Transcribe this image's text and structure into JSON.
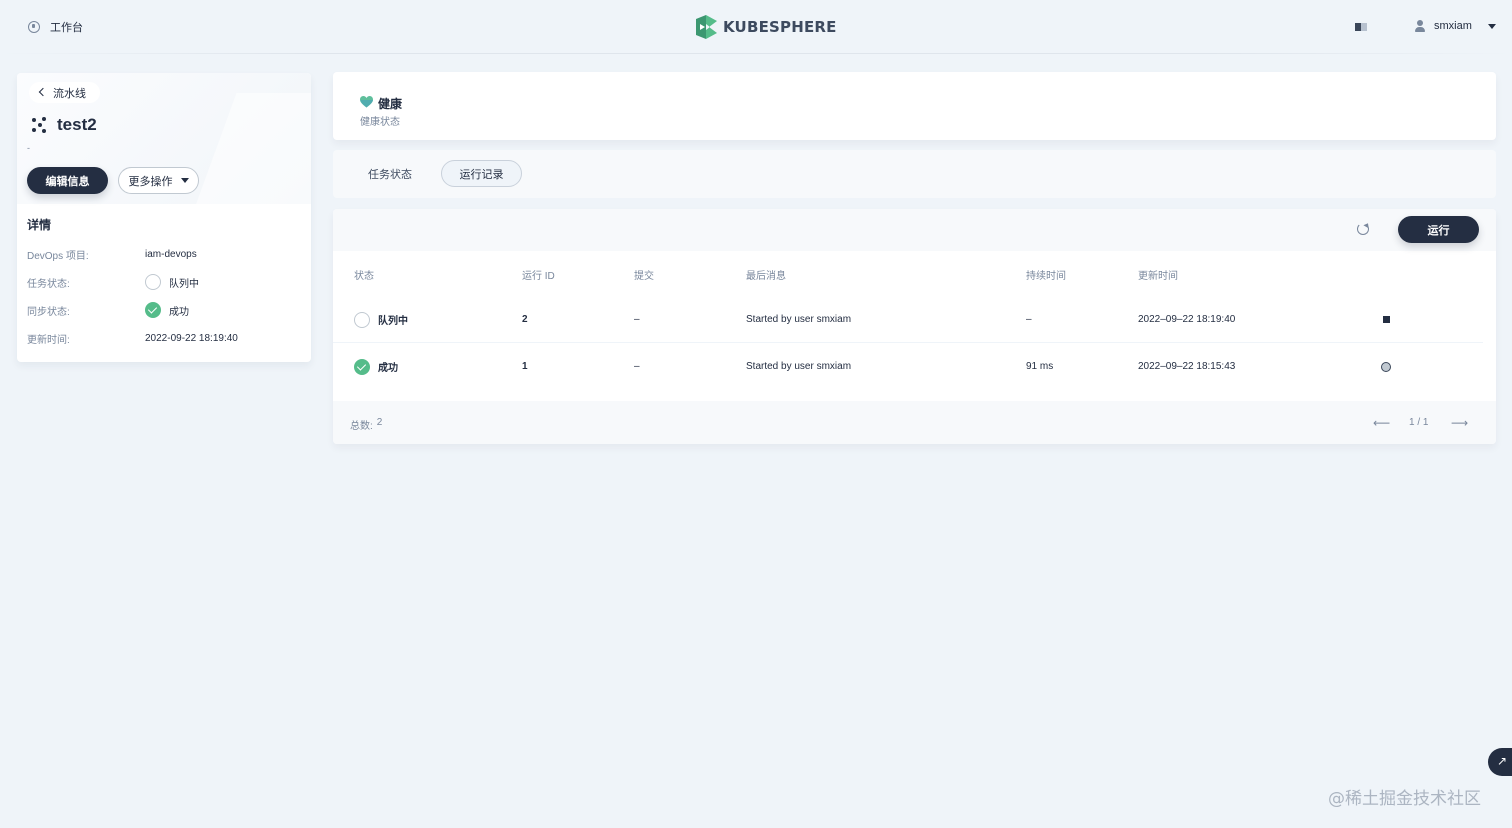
{
  "header": {
    "workbench_label": "工作台",
    "logo_text": "KUBESPHERE",
    "user_name": "smxiam"
  },
  "pipeline": {
    "back_label": "流水线",
    "name": "test2",
    "description": "-",
    "edit_button": "编辑信息",
    "more_button": "更多操作",
    "details_title": "详情",
    "details": [
      {
        "key": "DevOps 项目:",
        "value": "iam-devops",
        "icon": ""
      },
      {
        "key": "任务状态:",
        "value": "队列中",
        "icon": "queued-circle-icon"
      },
      {
        "key": "同步状态:",
        "value": "成功",
        "icon": "success-check-icon"
      },
      {
        "key": "更新时间:",
        "value": "2022-09-22 18:19:40",
        "icon": ""
      }
    ]
  },
  "health": {
    "title": "健康",
    "subtitle": "健康状态",
    "accent_color": "#55bc8a"
  },
  "tabs": [
    {
      "label": "任务状态",
      "active": false
    },
    {
      "label": "运行记录",
      "active": true
    }
  ],
  "runs": {
    "run_button": "运行",
    "columns": [
      "状态",
      "运行 ID",
      "提交",
      "最后消息",
      "持续时间",
      "更新时间"
    ],
    "rows": [
      {
        "status": "队列中",
        "status_icon": "queued-circle-icon",
        "id": "2",
        "commit": "–",
        "message": "Started by user smxiam",
        "duration": "–",
        "updated": "2022–09–22 18:19:40",
        "action_icon": "stop-icon"
      },
      {
        "status": "成功",
        "status_icon": "success-check-icon",
        "id": "1",
        "commit": "–",
        "message": "Started by user smxiam",
        "duration": "91 ms",
        "updated": "2022–09–22 18:15:43",
        "action_icon": "replay-icon"
      }
    ],
    "total_label": "总数:",
    "total": "2",
    "page_info": "1 / 1"
  },
  "watermark": "@稀土掘金技术社区"
}
